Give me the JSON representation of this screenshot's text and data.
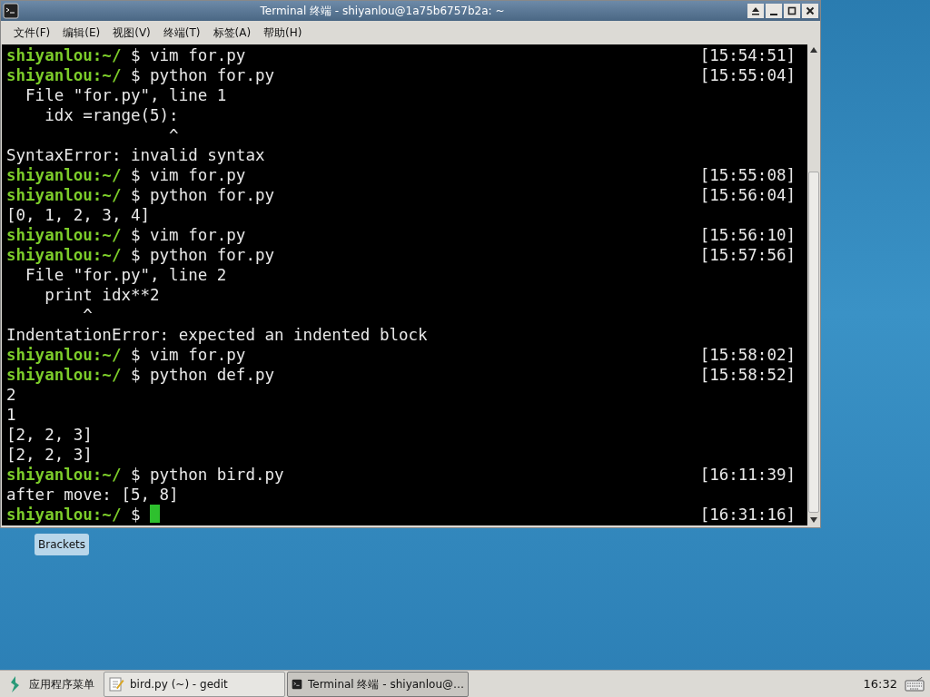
{
  "window": {
    "title": "Terminal 终端 - shiyanlou@1a75b6757b2a: ~"
  },
  "menu": [
    "文件(F)",
    "编辑(E)",
    "视图(V)",
    "终端(T)",
    "标签(A)",
    "帮助(H)"
  ],
  "terminal": {
    "lines": [
      {
        "kind": "prompt",
        "prompt": "shiyanlou:~/",
        "command": " $ vim for.py",
        "time": "[15:54:51]"
      },
      {
        "kind": "prompt",
        "prompt": "shiyanlou:~/",
        "command": " $ python for.py",
        "time": "[15:55:04]"
      },
      {
        "kind": "output",
        "text": "  File \"for.py\", line 1"
      },
      {
        "kind": "output",
        "text": "    idx =range(5):"
      },
      {
        "kind": "output",
        "text": "                 ^"
      },
      {
        "kind": "output",
        "text": "SyntaxError: invalid syntax"
      },
      {
        "kind": "prompt",
        "prompt": "shiyanlou:~/",
        "command": " $ vim for.py",
        "time": "[15:55:08]"
      },
      {
        "kind": "prompt",
        "prompt": "shiyanlou:~/",
        "command": " $ python for.py",
        "time": "[15:56:04]"
      },
      {
        "kind": "output",
        "text": "[0, 1, 2, 3, 4]"
      },
      {
        "kind": "prompt",
        "prompt": "shiyanlou:~/",
        "command": " $ vim for.py",
        "time": "[15:56:10]"
      },
      {
        "kind": "prompt",
        "prompt": "shiyanlou:~/",
        "command": " $ python for.py",
        "time": "[15:57:56]"
      },
      {
        "kind": "output",
        "text": "  File \"for.py\", line 2"
      },
      {
        "kind": "output",
        "text": "    print idx**2"
      },
      {
        "kind": "output",
        "text": "        ^"
      },
      {
        "kind": "output",
        "text": "IndentationError: expected an indented block"
      },
      {
        "kind": "prompt",
        "prompt": "shiyanlou:~/",
        "command": " $ vim for.py",
        "time": "[15:58:02]"
      },
      {
        "kind": "prompt",
        "prompt": "shiyanlou:~/",
        "command": " $ python def.py",
        "time": "[15:58:52]"
      },
      {
        "kind": "output",
        "text": "2"
      },
      {
        "kind": "output",
        "text": "1"
      },
      {
        "kind": "output",
        "text": "[2, 2, 3]"
      },
      {
        "kind": "output",
        "text": "[2, 2, 3]"
      },
      {
        "kind": "prompt",
        "prompt": "shiyanlou:~/",
        "command": " $ python bird.py",
        "time": "[16:11:39]"
      },
      {
        "kind": "output",
        "text": "after move: [5, 8]"
      },
      {
        "kind": "prompt",
        "prompt": "shiyanlou:~/",
        "command": " $ ",
        "time": "[16:31:16]",
        "cursor": true
      }
    ]
  },
  "desktop_icons": [
    {
      "label": "Brackets"
    }
  ],
  "taskbar": {
    "start_label": "应用程序菜单",
    "tasks": [
      {
        "label": "bird.py (~) - gedit",
        "kind": "editor",
        "selected": false
      },
      {
        "label": "Terminal 终端 - shiyanlou@…",
        "kind": "terminal",
        "selected": true
      }
    ],
    "clock": "16:32"
  }
}
